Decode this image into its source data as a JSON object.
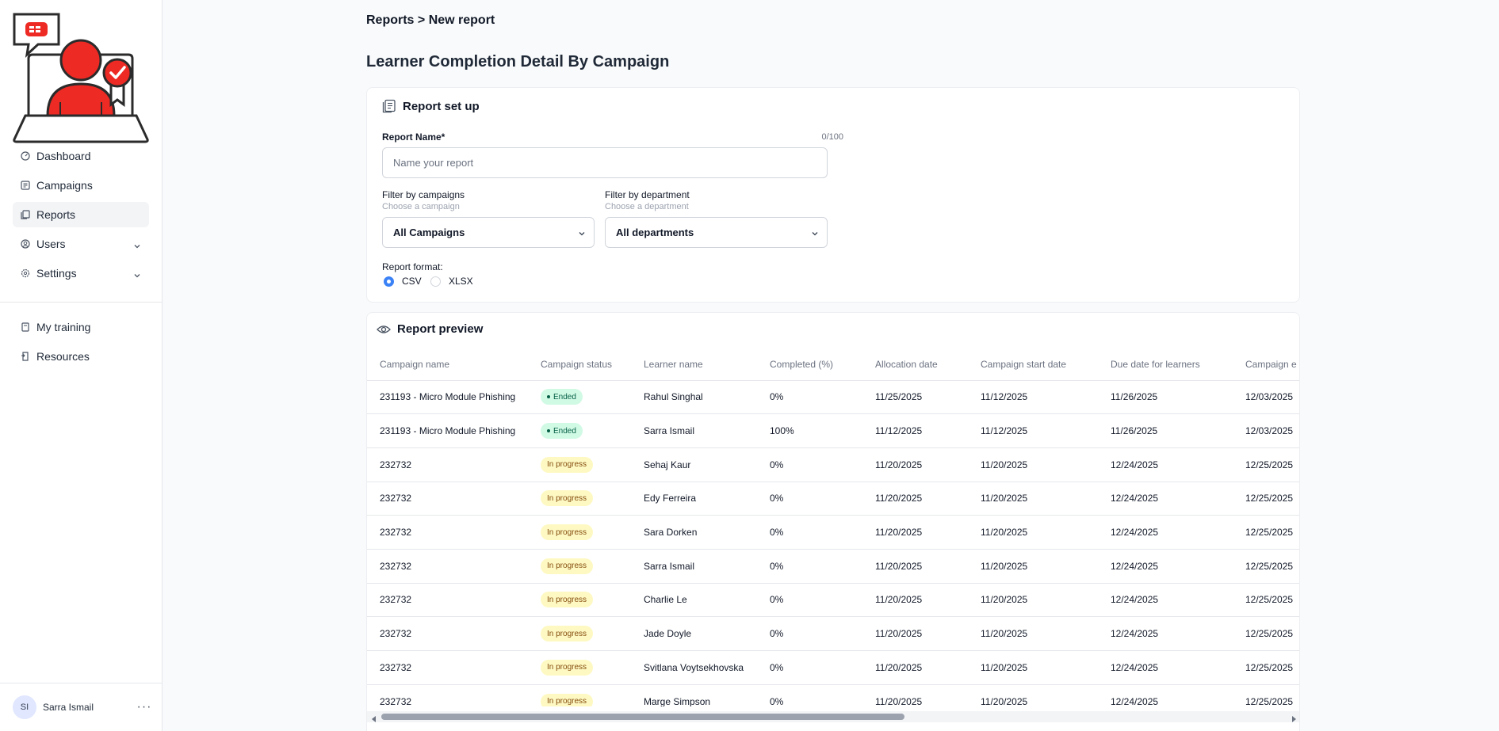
{
  "breadcrumb": "Reports > New report",
  "page_title": "Learner Completion Detail By Campaign",
  "sidebar": {
    "items": [
      {
        "label": "Dashboard",
        "icon": "gauge-icon"
      },
      {
        "label": "Campaigns",
        "icon": "campaign-icon"
      },
      {
        "label": "Reports",
        "icon": "reports-icon",
        "active": true
      },
      {
        "label": "Users",
        "icon": "user-circle-icon",
        "expandable": true
      },
      {
        "label": "Settings",
        "icon": "gear-icon",
        "expandable": true
      }
    ],
    "secondary": [
      {
        "label": "My training",
        "icon": "book-icon"
      },
      {
        "label": "Resources",
        "icon": "resources-icon"
      }
    ],
    "user": {
      "initials": "SI",
      "name": "Sarra Ismail",
      "more": "···"
    }
  },
  "setup": {
    "heading": "Report set up",
    "name_label": "Report Name*",
    "name_counter": "0/100",
    "name_value": "",
    "name_placeholder": "Name your report",
    "campaign_label": "Filter by campaigns",
    "campaign_hint": "Choose a campaign",
    "campaign_value": "All Campaigns",
    "department_label": "Filter by department",
    "department_hint": "Choose a department",
    "department_value": "All departments",
    "format_label": "Report format:",
    "formats": [
      {
        "label": "CSV",
        "selected": true
      },
      {
        "label": "XLSX",
        "selected": false
      }
    ]
  },
  "preview": {
    "heading": "Report preview",
    "columns": [
      "Campaign name",
      "Campaign status",
      "Learner name",
      "Completed (%)",
      "Allocation date",
      "Campaign start date",
      "Due date for learners",
      "Campaign e"
    ],
    "rows": [
      [
        "231193 - Micro Module Phishing",
        "Ended",
        "Rahul Singhal",
        "0%",
        "11/25/2025",
        "11/12/2025",
        "11/26/2025",
        "12/03/2025"
      ],
      [
        "231193 - Micro Module Phishing",
        "Ended",
        "Sarra Ismail",
        "100%",
        "11/12/2025",
        "11/12/2025",
        "11/26/2025",
        "12/03/2025"
      ],
      [
        "232732",
        "In progress",
        "Sehaj Kaur",
        "0%",
        "11/20/2025",
        "11/20/2025",
        "12/24/2025",
        "12/25/2025"
      ],
      [
        "232732",
        "In progress",
        "Edy Ferreira",
        "0%",
        "11/20/2025",
        "11/20/2025",
        "12/24/2025",
        "12/25/2025"
      ],
      [
        "232732",
        "In progress",
        "Sara Dorken",
        "0%",
        "11/20/2025",
        "11/20/2025",
        "12/24/2025",
        "12/25/2025"
      ],
      [
        "232732",
        "In progress",
        "Sarra Ismail",
        "0%",
        "11/20/2025",
        "11/20/2025",
        "12/24/2025",
        "12/25/2025"
      ],
      [
        "232732",
        "In progress",
        "Charlie Le",
        "0%",
        "11/20/2025",
        "11/20/2025",
        "12/24/2025",
        "12/25/2025"
      ],
      [
        "232732",
        "In progress",
        "Jade Doyle",
        "0%",
        "11/20/2025",
        "11/20/2025",
        "12/24/2025",
        "12/25/2025"
      ],
      [
        "232732",
        "In progress",
        "Svitlana Voytsekhovska",
        "0%",
        "11/20/2025",
        "11/20/2025",
        "12/24/2025",
        "12/25/2025"
      ],
      [
        "232732",
        "In progress",
        "Marge Simpson",
        "0%",
        "11/20/2025",
        "11/20/2025",
        "12/24/2025",
        "12/25/2025"
      ]
    ]
  },
  "colors": {
    "accent": "#3b82f6",
    "logo_red": "#ee2a24",
    "ended_bg": "#d1fae5",
    "progress_bg": "#fef9c3"
  }
}
